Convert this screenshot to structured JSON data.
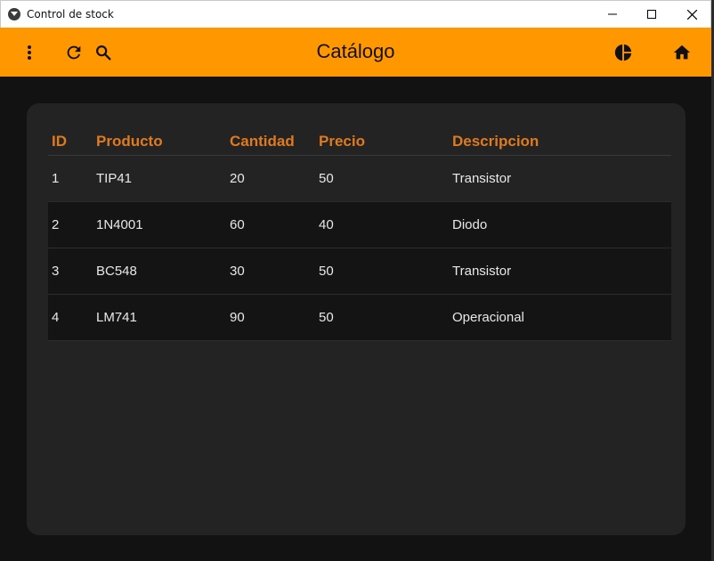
{
  "window": {
    "title": "Control de stock"
  },
  "toolbar": {
    "title": "Catálogo"
  },
  "colors": {
    "toolbar_bg": "#ff9800",
    "header_text": "#e07a1f",
    "background": "#121212",
    "card_bg": "#232323"
  },
  "table": {
    "headers": [
      "ID",
      "Producto",
      "Cantidad",
      "Precio",
      "Descripcion"
    ],
    "rows": [
      [
        "1",
        "TIP41",
        "20",
        "50",
        "Transistor"
      ],
      [
        "2",
        "1N4001",
        "60",
        "40",
        "Diodo"
      ],
      [
        "3",
        "BC548",
        "30",
        "50",
        "Transistor"
      ],
      [
        "4",
        "LM741",
        "90",
        "50",
        "Operacional"
      ]
    ]
  }
}
